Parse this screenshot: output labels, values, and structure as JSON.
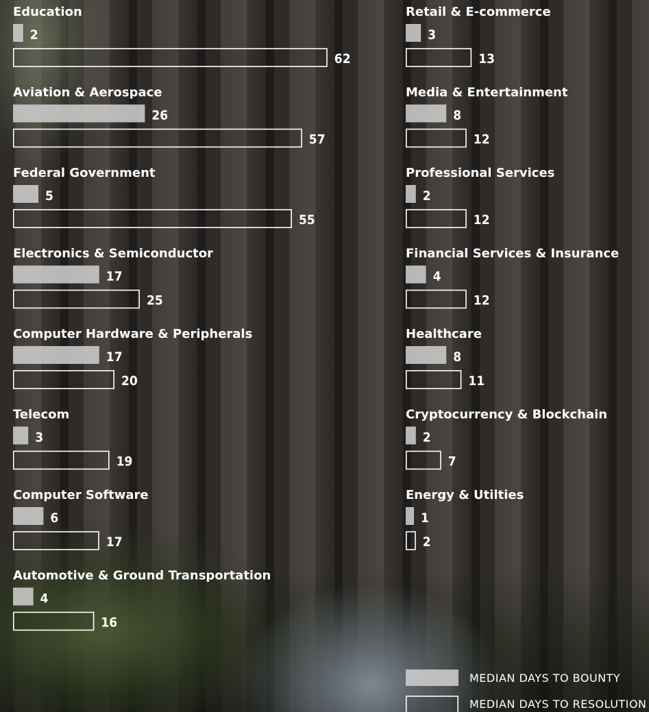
{
  "chart_data": {
    "type": "bar",
    "orientation": "horizontal",
    "series": [
      {
        "name": "MEDIAN DAYS TO BOUNTY",
        "style": "filled",
        "color": "#cdcdcd"
      },
      {
        "name": "MEDIAN DAYS TO RESOLUTION",
        "style": "outlined",
        "color": "#ffffff"
      }
    ],
    "categories": [
      {
        "name": "Education",
        "bounty": 2,
        "resolution": 62
      },
      {
        "name": "Aviation & Aerospace",
        "bounty": 26,
        "resolution": 57
      },
      {
        "name": "Federal Government",
        "bounty": 5,
        "resolution": 55
      },
      {
        "name": "Electronics & Semiconductor",
        "bounty": 17,
        "resolution": 25
      },
      {
        "name": "Computer Hardware & Peripherals",
        "bounty": 17,
        "resolution": 20
      },
      {
        "name": "Telecom",
        "bounty": 3,
        "resolution": 19
      },
      {
        "name": "Computer Software",
        "bounty": 6,
        "resolution": 17
      },
      {
        "name": "Automotive & Ground Transportation",
        "bounty": 4,
        "resolution": 16
      },
      {
        "name": "Retail & E-commerce",
        "bounty": 3,
        "resolution": 13
      },
      {
        "name": "Media & Entertainment",
        "bounty": 8,
        "resolution": 12
      },
      {
        "name": "Professional Services",
        "bounty": 2,
        "resolution": 12
      },
      {
        "name": "Financial Services & Insurance",
        "bounty": 4,
        "resolution": 12
      },
      {
        "name": "Healthcare",
        "bounty": 8,
        "resolution": 11
      },
      {
        "name": "Cryptocurrency & Blockchain",
        "bounty": 2,
        "resolution": 7
      },
      {
        "name": "Energy & Utilties",
        "bounty": 1,
        "resolution": 2
      }
    ],
    "legend": {
      "placement": "bottom-right",
      "entries": [
        "MEDIAN DAYS TO BOUNTY",
        "MEDIAN DAYS TO RESOLUTION"
      ]
    }
  }
}
